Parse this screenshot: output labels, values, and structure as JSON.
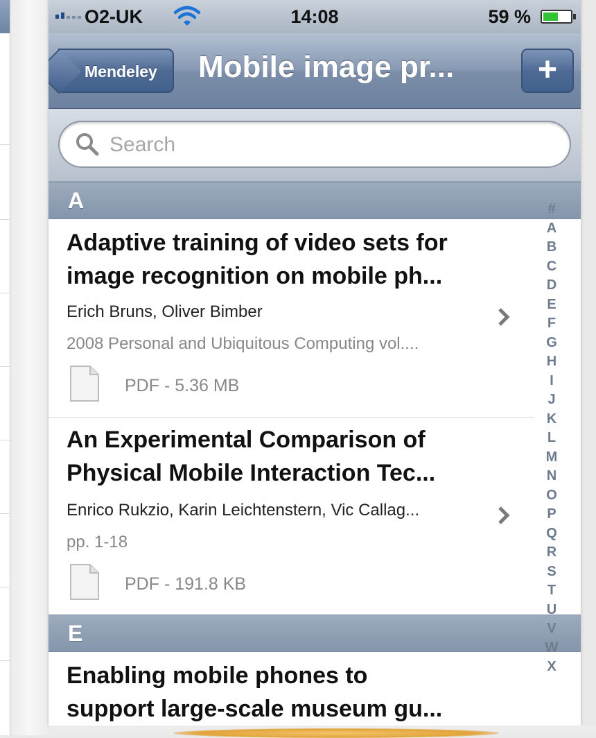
{
  "status_bar": {
    "carrier": "O2-UK",
    "time": "14:08",
    "battery": "59 %",
    "battery_level": 0.59
  },
  "nav_bar": {
    "back_label": "Mendeley",
    "title": "Mobile image pr...",
    "add_label": "+"
  },
  "search": {
    "placeholder": "Search",
    "value": ""
  },
  "sections": [
    {
      "letter": "A",
      "documents": [
        {
          "title_line1": "Adaptive training of video sets for",
          "title_line2": "image recognition on mobile ph...",
          "authors": "Erich Bruns, Oliver Bimber",
          "source": "2008 Personal and Ubiquitous Computing vol....",
          "file": "PDF - 5.36 MB"
        },
        {
          "title_line1": "An Experimental Comparison of",
          "title_line2": "Physical Mobile Interaction Tec...",
          "authors": "Enrico Rukzio, Karin Leichtenstern, Vic Callag...",
          "source": "pp. 1-18",
          "file": "PDF - 191.8 KB"
        }
      ]
    },
    {
      "letter": "E",
      "documents": [
        {
          "title_line1": "Enabling mobile phones to",
          "title_line2": "support large-scale museum gu..."
        }
      ]
    }
  ],
  "index": [
    "#",
    "A",
    "B",
    "C",
    "D",
    "E",
    "F",
    "G",
    "H",
    "I",
    "J",
    "K",
    "L",
    "M",
    "N",
    "O",
    "P",
    "Q",
    "R",
    "S",
    "T",
    "U",
    "V",
    "W",
    "X"
  ],
  "colors": {
    "nav_bar": "#7b8ea9",
    "section_header": "#8c9bb0",
    "battery_fill": "#33c233"
  }
}
